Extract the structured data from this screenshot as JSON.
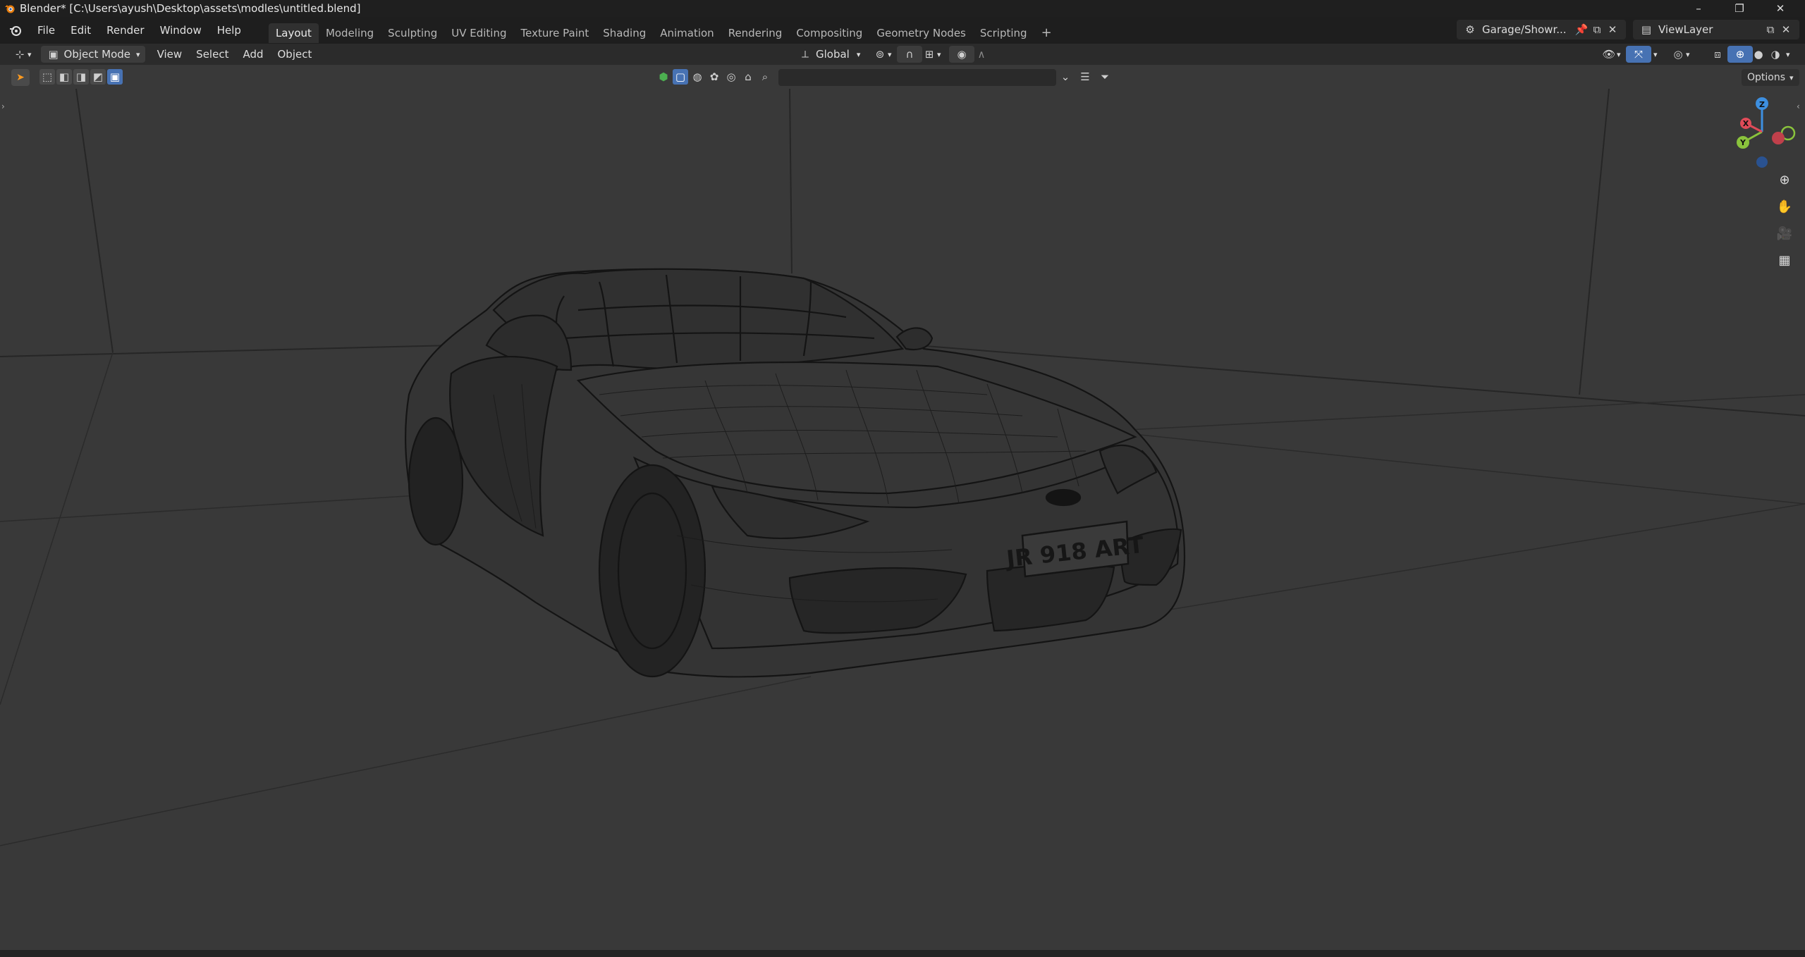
{
  "window": {
    "title": "Blender* [C:\\Users\\ayush\\Desktop\\assets\\modles\\untitled.blend]",
    "controls": [
      "–",
      "❐",
      "✕"
    ]
  },
  "menus": [
    "File",
    "Edit",
    "Render",
    "Window",
    "Help"
  ],
  "workspaces": [
    {
      "label": "Layout",
      "active": true
    },
    {
      "label": "Modeling",
      "active": false
    },
    {
      "label": "Sculpting",
      "active": false
    },
    {
      "label": "UV Editing",
      "active": false
    },
    {
      "label": "Texture Paint",
      "active": false
    },
    {
      "label": "Shading",
      "active": false
    },
    {
      "label": "Animation",
      "active": false
    },
    {
      "label": "Rendering",
      "active": false
    },
    {
      "label": "Compositing",
      "active": false
    },
    {
      "label": "Geometry Nodes",
      "active": false
    },
    {
      "label": "Scripting",
      "active": false
    }
  ],
  "add_workspace": "+",
  "scene": {
    "name": "Garage/Showr..."
  },
  "view_layer": {
    "name": "ViewLayer"
  },
  "header": {
    "mode": "Object Mode",
    "menus": [
      "View",
      "Select",
      "Add",
      "Object"
    ],
    "transform_orientation": "Global",
    "options_label": "Options"
  },
  "gizmo": {
    "x": "X",
    "y": "Y",
    "z": "Z"
  },
  "scene_content": {
    "license_plate": "JR 918 ART"
  },
  "colors": {
    "accent": "#4772b3",
    "viewport_bg": "#393939",
    "wire": "#161616",
    "axis_x": "#e04b58",
    "axis_y": "#8ac33c",
    "axis_z": "#3d8fe0"
  },
  "icons": {
    "blender": "blender-logo-icon",
    "editor": "3d-viewport-editor-icon",
    "select_box": "select-box-tool-icon",
    "search": "search-icon",
    "filter": "filter-icon",
    "zoom": "zoom-icon",
    "pan": "hand-pan-icon",
    "camera": "camera-view-icon",
    "grid": "ortho-grid-icon"
  }
}
